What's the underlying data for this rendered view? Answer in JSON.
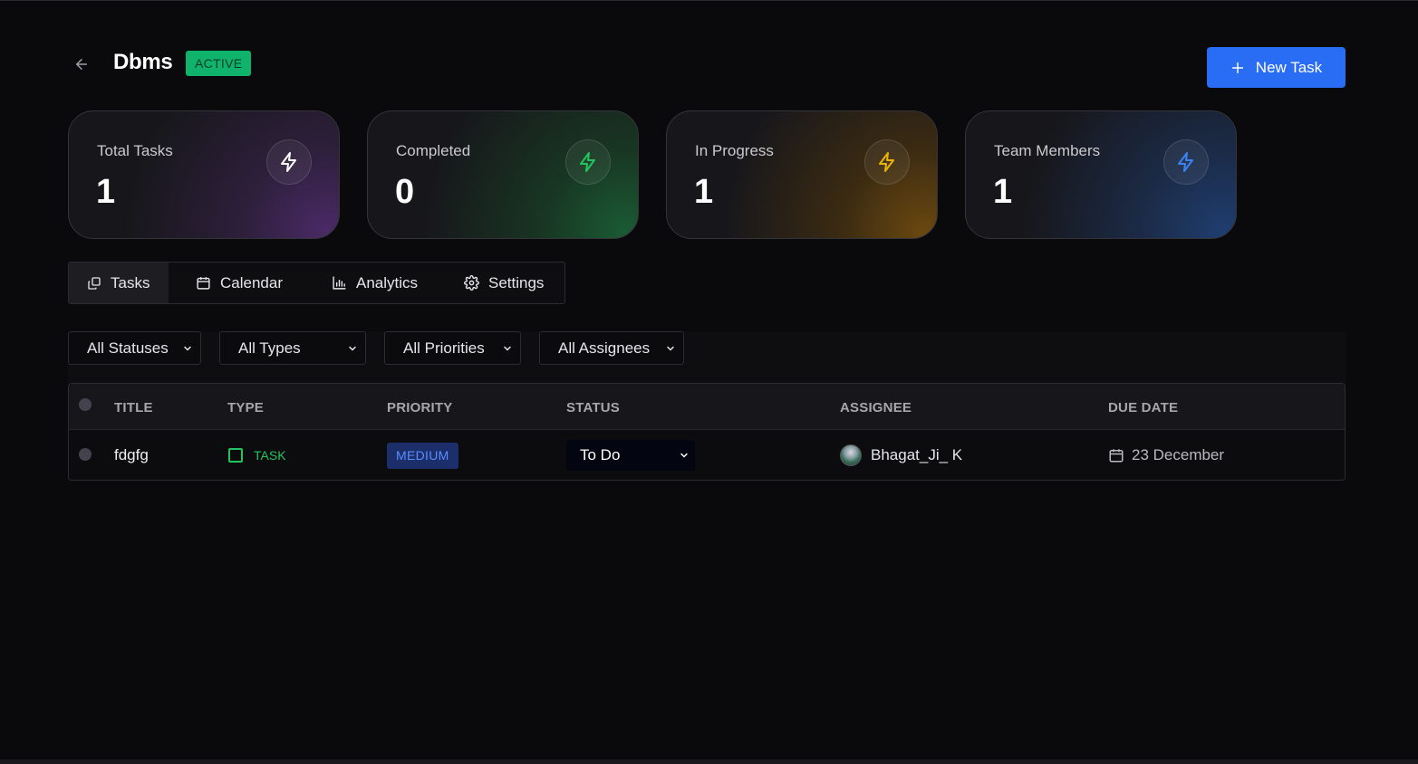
{
  "header": {
    "title": "Dbms",
    "status": "ACTIVE",
    "new_task_label": "New Task"
  },
  "stats": [
    {
      "label": "Total Tasks",
      "value": "1",
      "accent": "#ffffff"
    },
    {
      "label": "Completed",
      "value": "0",
      "accent": "#22c55e"
    },
    {
      "label": "In Progress",
      "value": "1",
      "accent": "#eab308"
    },
    {
      "label": "Team Members",
      "value": "1",
      "accent": "#3b82f6"
    }
  ],
  "tabs": [
    {
      "label": "Tasks",
      "icon": "tasks-icon",
      "active": true
    },
    {
      "label": "Calendar",
      "icon": "calendar-icon",
      "active": false
    },
    {
      "label": "Analytics",
      "icon": "chart-icon",
      "active": false
    },
    {
      "label": "Settings",
      "icon": "gear-icon",
      "active": false
    }
  ],
  "filters": [
    {
      "label": "All Statuses"
    },
    {
      "label": "All Types"
    },
    {
      "label": "All Priorities"
    },
    {
      "label": "All Assignees"
    }
  ],
  "table": {
    "columns": [
      "TITLE",
      "TYPE",
      "PRIORITY",
      "STATUS",
      "ASSIGNEE",
      "DUE DATE"
    ],
    "rows": [
      {
        "title": "fdgfg",
        "type": "TASK",
        "priority": "MEDIUM",
        "status": "To Do",
        "assignee": "Bhagat_Ji_ K",
        "due_date": "23 December"
      }
    ]
  },
  "colors": {
    "accent_blue": "#2a6df5",
    "active_badge": "#10b36b",
    "type_green": "#22c55e",
    "priority_blue": "#5a8dff"
  }
}
